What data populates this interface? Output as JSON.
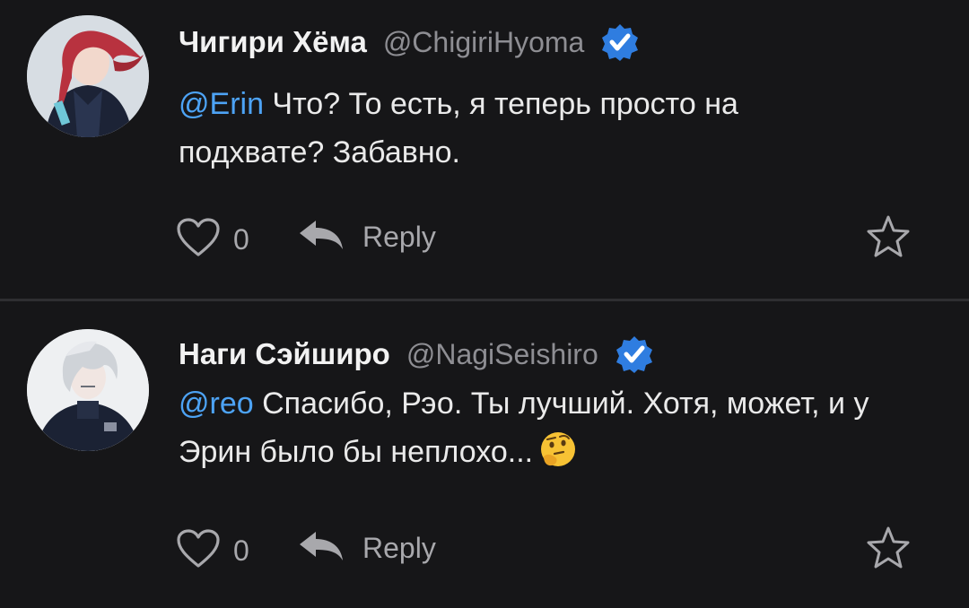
{
  "comments": [
    {
      "name": "Чигири Хёма",
      "handle": "@ChigiriHyoma",
      "mention": "@Erin",
      "text": " Что? То есть, я теперь просто на подхвате? Забавно.",
      "likes": "0",
      "reply_label": "Reply"
    },
    {
      "name": "Наги Сэйширо",
      "handle": "@NagiSeishiro",
      "mention": "@reo",
      "text": " Спасибо, Рэо. Ты лучший. Хотя, может, и у Эрин было бы неплохо...",
      "likes": "0",
      "reply_label": "Reply"
    }
  ],
  "colors": {
    "background": "#161618",
    "mention": "#4da3f5",
    "verified_badge": "#2f7de0",
    "muted": "#8e8e93"
  },
  "icons": [
    "verified-badge-icon",
    "heart-icon",
    "reply-arrow-icon",
    "star-icon",
    "thinking-face-emoji"
  ]
}
